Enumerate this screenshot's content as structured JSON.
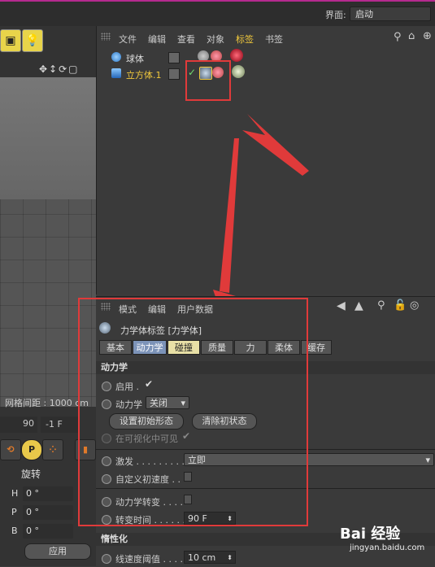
{
  "topbar": {
    "label": "界面:",
    "layout_value": "启动"
  },
  "left": {
    "grid_spacing": "网格间距 : 1000 cm",
    "frame_value": "90",
    "frame_field": "-1 F",
    "rotation_label": "旋转",
    "hpb": [
      {
        "key": "H",
        "value": "0 °"
      },
      {
        "key": "P",
        "value": "0 °"
      },
      {
        "key": "B",
        "value": "0 °"
      }
    ],
    "apply_label": "应用",
    "p_button": "P"
  },
  "objmgr": {
    "menu": [
      "文件",
      "编辑",
      "查看",
      "对象",
      "标签",
      "书签"
    ],
    "active_menu": "标签",
    "objects": [
      {
        "name": "球体",
        "selected": false
      },
      {
        "name": "立方体.1",
        "selected": true
      }
    ]
  },
  "attr": {
    "menu": [
      "模式",
      "编辑",
      "用户数据"
    ],
    "tag_title": "力学体标签 [力学体]",
    "tabs": [
      "基本",
      "动力学",
      "碰撞",
      "质量",
      "力",
      "柔体",
      "缓存"
    ],
    "section_dynamics": "动力学",
    "enable_label": "启用 .",
    "enable_check": "✔",
    "dynamics_label": "动力学",
    "dynamics_value": "关闭",
    "set_initial_btn": "设置初始形态",
    "clear_initial_btn": "清除初状态",
    "visible_label": "在可视化中可见",
    "visible_check": "✔",
    "trigger_label": "激发 . . . . . . . . . .",
    "trigger_value": "立即",
    "custom_velocity_label": "自定义初速度 . .",
    "dyn_transition_label": "动力学转变 . . . .",
    "transition_time_label": "转变时间 . . . . . .",
    "transition_time_value": "90 F",
    "section_inertia": "惰性化",
    "linear_threshold_label": "线速度阈值 . . . .",
    "linear_threshold_value": "10 cm"
  },
  "watermark": {
    "brand": "Bai 经验",
    "url": "jingyan.baidu.com"
  },
  "colors": {
    "accent_yellow": "#f0c83c",
    "highlight_red": "#e03a3a",
    "tab_active": "#7c93b8"
  }
}
